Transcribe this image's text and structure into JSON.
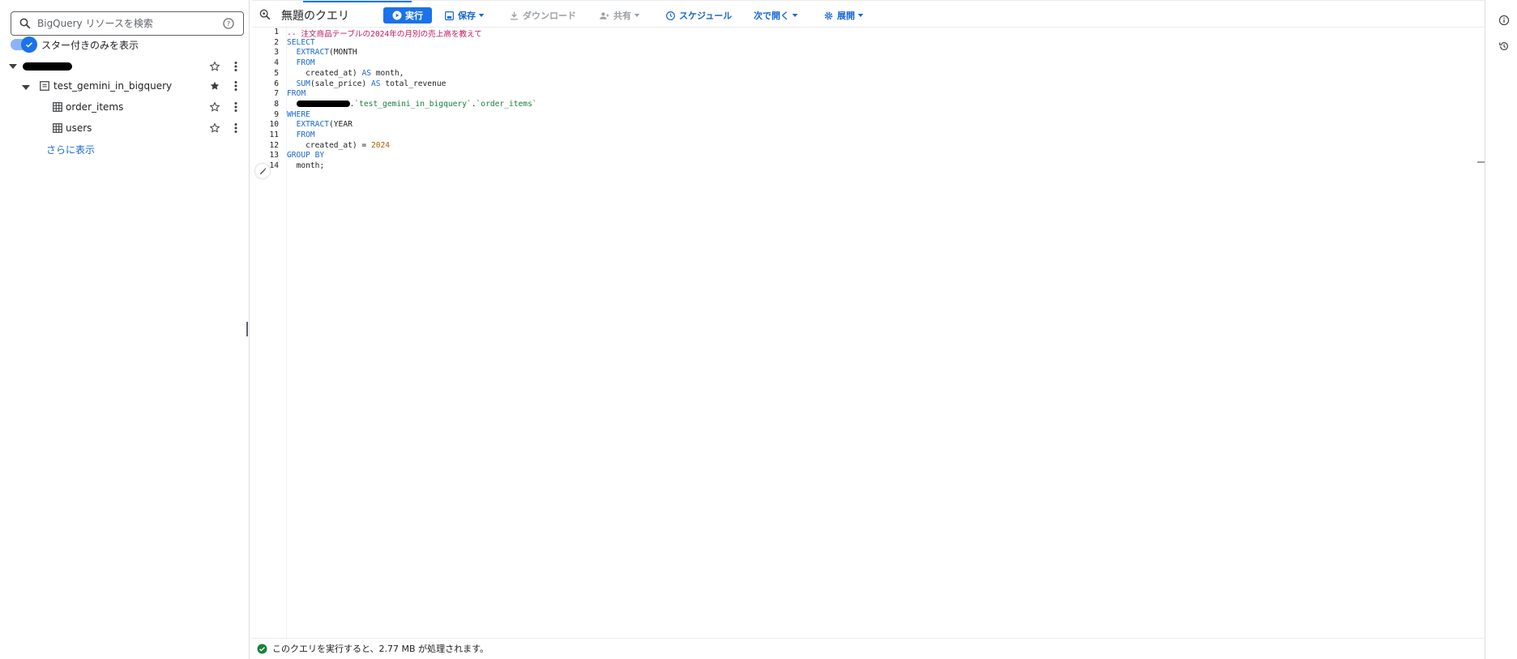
{
  "explorer": {
    "search": {
      "placeholder": "BigQuery リソースを検索"
    },
    "starred_toggle": {
      "label": "スター付きのみを表示",
      "on": true
    },
    "dataset": {
      "name": "test_gemini_in_bigquery",
      "starred": true
    },
    "tables": [
      {
        "name": "order_items",
        "starred": false
      },
      {
        "name": "users",
        "starred": false
      }
    ],
    "show_more": "さらに表示"
  },
  "toolbar": {
    "title": "無題のクエリ",
    "run": "実行",
    "save": "保存",
    "download": "ダウンロード",
    "share": "共有",
    "schedule": "スケジュール",
    "open_in": "次で開く",
    "deploy": "展開"
  },
  "editor": {
    "line_numbers": [
      "1",
      "2",
      "3",
      "4",
      "5",
      "6",
      "7",
      "8",
      "9",
      "10",
      "11",
      "12",
      "13",
      "14"
    ],
    "lines": {
      "l1": "-- 注文商品テーブルの2024年の月別の売上高を教えて",
      "l2": "SELECT",
      "l3a": "EXTRACT",
      "l3b": "(MONTH",
      "l4": "FROM",
      "l5a": "created_at)",
      "l5b": "AS",
      "l5c": "month,",
      "l6a": "SUM",
      "l6b": "(sale_price)",
      "l6c": "AS",
      "l6d": "total_revenue",
      "l7": "FROM",
      "l8a": ".",
      "l8b": "`test_gemini_in_bigquery`",
      "l8c": ".",
      "l8d": "`order_items`",
      "l9": "WHERE",
      "l10a": "EXTRACT",
      "l10b": "(YEAR",
      "l11": "FROM",
      "l12a": "created_at) =",
      "l12b": "2024",
      "l13": "GROUP BY",
      "l14": "month;"
    }
  },
  "status": {
    "message": "このクエリを実行すると、2.77 MB が処理されます。"
  },
  "colors": {
    "accent": "#1a73e8",
    "keyword": "#1967d2",
    "comment": "#c2185b",
    "string": "#188038",
    "number": "#b06000",
    "success": "#188038"
  }
}
